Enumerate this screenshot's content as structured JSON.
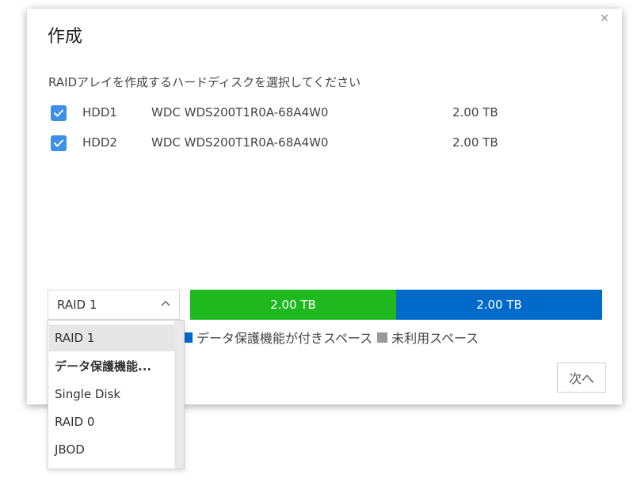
{
  "dialog": {
    "title": "作成",
    "close_glyph": "×",
    "instruction": "RAIDアレイを作成するハードディスクを選択してください"
  },
  "disks": [
    {
      "name": "HDD1",
      "model": "WDC WDS200T1R0A-68A4W0",
      "size": "2.00 TB",
      "checked": true
    },
    {
      "name": "HDD2",
      "model": "WDC WDS200T1R0A-68A4W0",
      "size": "2.00 TB",
      "checked": true
    }
  ],
  "raid_select": {
    "value": "RAID 1",
    "icon": "chevron-up-icon"
  },
  "capacity_bar": {
    "protected": {
      "label": "2.00 TB",
      "color": "#1fb81f",
      "fraction": 0.5
    },
    "unused": {
      "label": "2.00 TB",
      "color": "#006ac9",
      "fraction": 0.5
    }
  },
  "legend": {
    "protected_label": "データ保護機能が付きスペース",
    "unused_label": "未利用スペース",
    "protected_color": "#006ac9",
    "unused_color": "#9a9a9a"
  },
  "next_button": {
    "label": "次へ"
  },
  "dropdown": {
    "options": [
      {
        "label": "RAID 1",
        "selected": true,
        "group": false
      },
      {
        "label": "データ保護機能...",
        "selected": false,
        "group": true
      },
      {
        "label": "Single Disk",
        "selected": false,
        "group": false
      },
      {
        "label": "RAID 0",
        "selected": false,
        "group": false
      },
      {
        "label": "JBOD",
        "selected": false,
        "group": false
      }
    ]
  },
  "colors": {
    "accent": "#3d8fe8"
  }
}
